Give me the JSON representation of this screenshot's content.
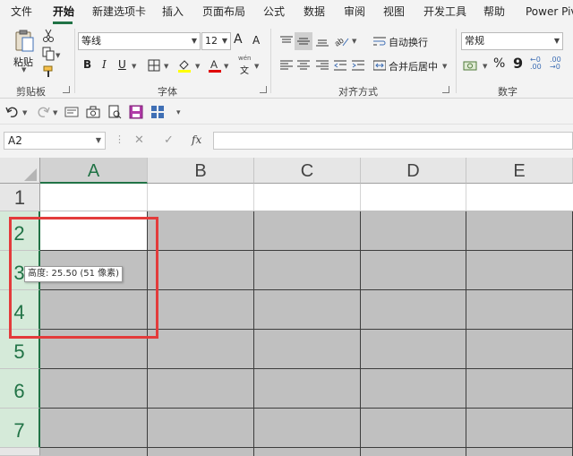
{
  "tabs": [
    "文件",
    "开始",
    "新建选项卡",
    "插入",
    "页面布局",
    "公式",
    "数据",
    "审阅",
    "视图",
    "开发工具",
    "帮助",
    "Power Piv"
  ],
  "active_tab": "开始",
  "clipboard": {
    "paste_label": "粘贴",
    "group_label": "剪贴板"
  },
  "font": {
    "name": "等线",
    "size": "12",
    "group_label": "字体",
    "bold": "B",
    "italic": "I",
    "underline": "U",
    "grow": "A",
    "shrink": "A",
    "phonetic_top": "wén",
    "phonetic_bottom": "文",
    "font_color": "A"
  },
  "alignment": {
    "wrap_label": "自动换行",
    "merge_label": "合并后居中",
    "group_label": "对齐方式"
  },
  "number": {
    "format": "常规",
    "group_label": "数字",
    "percent": "%",
    "comma": "9",
    "inc_decimal": "←0 .00",
    "dec_decimal": ".00 →0"
  },
  "formula_bar": {
    "name_box": "A2",
    "fx": "fx"
  },
  "grid": {
    "columns": [
      "A",
      "B",
      "C",
      "D",
      "E"
    ],
    "rows": [
      "1",
      "2",
      "3",
      "4",
      "5",
      "6",
      "7"
    ],
    "selected_column": "A",
    "tooltip": "高度: 25.50 (51 像素)"
  },
  "colors": {
    "accent": "#217346",
    "highlight_box": "#e33b3b",
    "selection_fill": "#c0c0c0"
  },
  "icons": [
    "undo-icon",
    "redo-icon",
    "form-icon",
    "camera-icon",
    "print-preview-icon",
    "save-icon",
    "grid-icon",
    "customize-qat-icon"
  ]
}
